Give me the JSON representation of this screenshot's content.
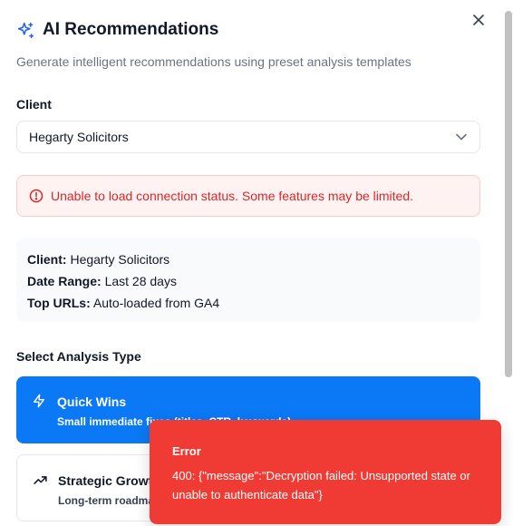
{
  "dialog": {
    "title": "AI Recommendations",
    "subtitle": "Generate intelligent recommendations using preset analysis templates",
    "close_icon": "close-icon"
  },
  "client": {
    "label": "Client",
    "selected": "Hegarty Solicitors"
  },
  "alert": {
    "message": "Unable to load connection status. Some features may be limited."
  },
  "info": {
    "client_label": "Client:",
    "client_value": "Hegarty Solicitors",
    "range_label": "Date Range:",
    "range_value": "Last 28 days",
    "urls_label": "Top URLs:",
    "urls_value": "Auto-loaded from GA4"
  },
  "analysis": {
    "label": "Select Analysis Type",
    "options": [
      {
        "title": "Quick Wins",
        "desc": "Small immediate fixes (titles, CTR, keywords)",
        "icon": "lightning-icon",
        "selected": true
      },
      {
        "title": "Strategic Growth",
        "desc": "Long-term roadmap",
        "icon": "trending-up-icon",
        "selected": false
      }
    ]
  },
  "toast": {
    "title": "Error",
    "message": "400: {\"message\":\"Decryption failed: Unsupported state or unable to authenticate data\"}"
  },
  "colors": {
    "primary": "#0b78f5",
    "error": "#f03a34",
    "alert_text": "#dc2626",
    "alert_bg": "#fef2f2"
  }
}
